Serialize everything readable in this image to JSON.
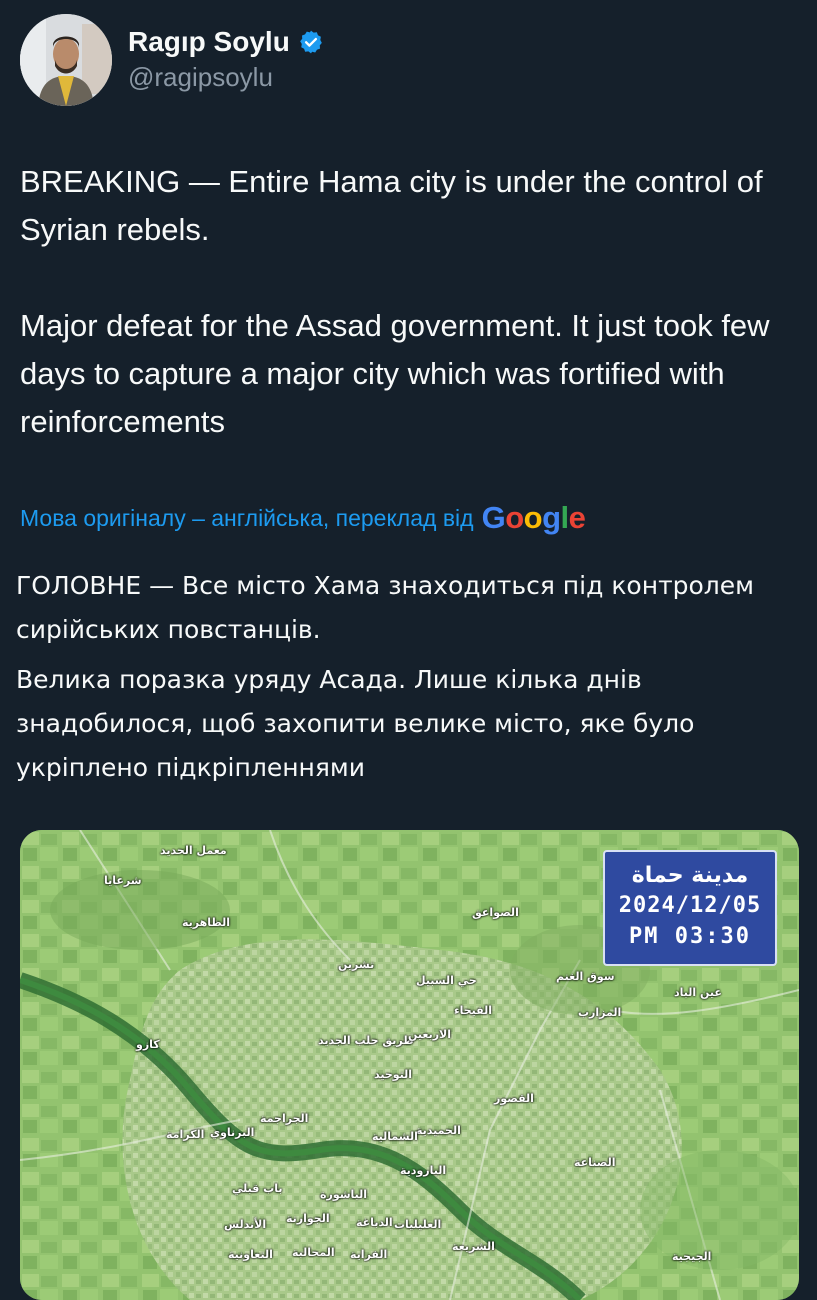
{
  "author": {
    "display_name": "Ragıp Soylu",
    "handle": "@ragipsoylu",
    "verified": true,
    "verified_color": "#1d9bf0",
    "avatar_icon": "profile-photo"
  },
  "tweet": {
    "paragraphs": [
      "BREAKING — Entire Hama city is under the control of Syrian rebels.",
      "Major defeat for the Assad government. It just took few days to capture a major city which was fortified with reinforcements"
    ]
  },
  "translation": {
    "label": "Мова оригіналу – англійська, переклад від",
    "provider": "Google",
    "provider_colors": [
      "#4285f4",
      "#ea4335",
      "#fbbc05",
      "#4285f4",
      "#34a853",
      "#ea4335"
    ],
    "paragraphs": [
      "ГОЛОВНЕ — Все місто Хама знаходиться під контролем сирійських повстанців.",
      "Велика поразка уряду Асада. Лише кілька днів знадобилося, щоб захопити велике місто, яке було укріплено підкріпленнями"
    ]
  },
  "media": {
    "info_box": {
      "title": "مدينة حماة",
      "date": "2024/12/05",
      "time": "PM 03:30"
    },
    "map_labels": [
      "معمل الحديد",
      "شرعايا",
      "الظاهرية",
      "الصواعق",
      "تشرين",
      "حي السبيل",
      "سوق الغنم",
      "عين الباد",
      "الفيحاء",
      "المزارب",
      "كازو",
      "طريق حلب الجديد",
      "الاربعين",
      "التوحيد",
      "القصور",
      "البرناوي",
      "الكرامة",
      "الجراجمة",
      "الحميدية",
      "الشمالية",
      "الصناعة",
      "البارودية",
      "باب قبلي",
      "الباشورة",
      "الجوارنة",
      "الأندلس",
      "الدباغة",
      "العليليات",
      "الشريعة",
      "التعاونية",
      "المحالبة",
      "الفراية",
      "الجيجية"
    ]
  }
}
